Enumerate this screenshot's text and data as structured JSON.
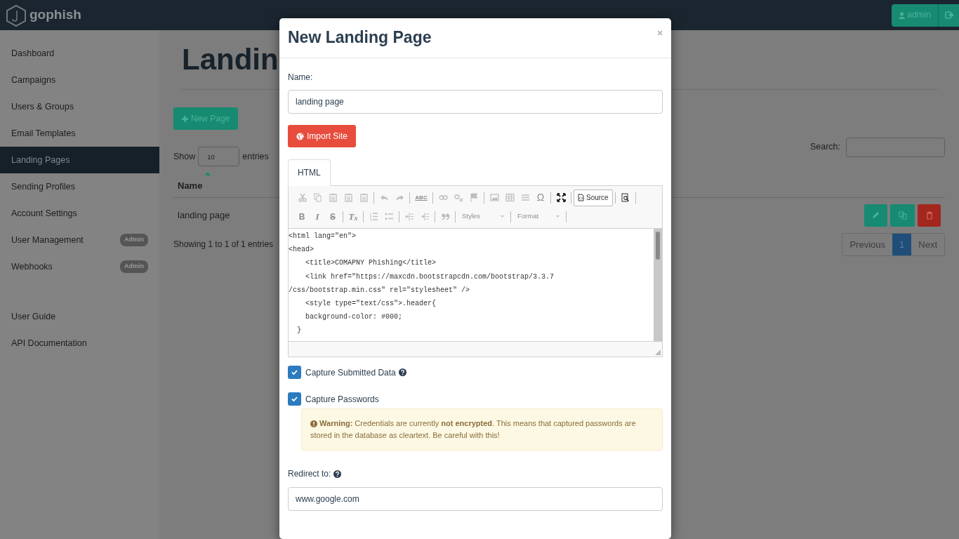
{
  "navbar": {
    "brand": "gophish",
    "user_button": "admin"
  },
  "sidebar": {
    "items": [
      {
        "label": "Dashboard",
        "selected": false
      },
      {
        "label": "Campaigns",
        "selected": false
      },
      {
        "label": "Users & Groups",
        "selected": false
      },
      {
        "label": "Email Templates",
        "selected": false
      },
      {
        "label": "Landing Pages",
        "selected": true
      },
      {
        "label": "Sending Profiles",
        "selected": false
      },
      {
        "label": "Account Settings",
        "selected": false
      },
      {
        "label": "User Management",
        "selected": false,
        "badge": "Admin"
      },
      {
        "label": "Webhooks",
        "selected": false,
        "badge": "Admin"
      }
    ],
    "links": [
      {
        "label": "User Guide"
      },
      {
        "label": "API Documentation"
      }
    ]
  },
  "page": {
    "title": "Landin",
    "new_button": "New Page",
    "show_label": "Show",
    "page_length": "10",
    "entries_label": "entries",
    "search_label": "Search:",
    "columns": [
      {
        "label": "Name",
        "sorted": true
      }
    ],
    "rows": [
      {
        "name": "landing page"
      }
    ],
    "info": "Showing 1 to 1 of 1 entries",
    "pagination": [
      {
        "label": "Previous",
        "selected": false
      },
      {
        "label": "1",
        "selected": true
      },
      {
        "label": "Next",
        "selected": false
      }
    ]
  },
  "modal": {
    "title": "New Landing Page",
    "name_label": "Name:",
    "name_value": "landing page",
    "import_button": "Import Site",
    "tabs": [
      {
        "label": "HTML",
        "selected": true
      }
    ],
    "editor": {
      "glyph_buttons": [
        "ABC",
        "Ω",
        "B",
        "I",
        "S",
        "T$_{x}$"
      ],
      "source_button": "Source",
      "combos": [
        {
          "label": "Styles",
          "disabled": true
        },
        {
          "label": "Format",
          "disabled": true
        }
      ],
      "code_lines": [
        "<html lang=\"en\">",
        "<head>",
        "    <title>COMAPNY Phishing</title>",
        "    <link href=\"https://maxcdn.bootstrapcdn.com/bootstrap/3.3.7",
        "/css/bootstrap.min.css\" rel=\"stylesheet\" />",
        "    <style type=\"text/css\">.header{",
        "    background-color: #000;",
        "  }"
      ]
    },
    "checkboxes": [
      {
        "label": "Capture Submitted Data",
        "checked": true,
        "help": true
      },
      {
        "label": "Capture Passwords",
        "checked": true,
        "help": false
      }
    ],
    "warning": "**Warning:** Credentials are currently **not encrypted**. This means that captured passwords are stored in the database as cleartext. Be careful with this!",
    "redirect_label": "Redirect to:",
    "redirect_help": true,
    "redirect_value": "www.google.com"
  }
}
